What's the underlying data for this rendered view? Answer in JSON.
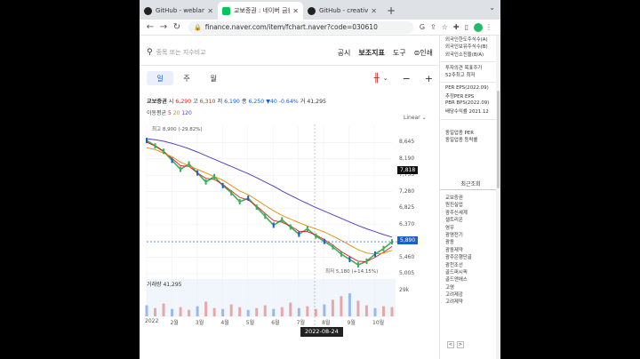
{
  "browser": {
    "tabs": [
      {
        "title": "GitHub - weblanks/Bl…",
        "favicon": "github-icon"
      },
      {
        "title": "교보증권 : 네이버 금융",
        "favicon": "naver-icon"
      },
      {
        "title": "GitHub - creativeduck…",
        "favicon": "github-icon"
      }
    ],
    "active_tab": 1,
    "new_tab": "+",
    "url": "finance.naver.com/item/fchart.naver?code=030610"
  },
  "search": {
    "placeholder": "종목 또는 지수비교",
    "menus": [
      "공시",
      "보조지표",
      "도구"
    ],
    "print": "인쇄"
  },
  "period": {
    "tabs": [
      "일",
      "주",
      "월"
    ],
    "active": 0
  },
  "price": {
    "name": "교보증권",
    "open_label": "시",
    "open": "6,290",
    "high_label": "고",
    "high": "6,310",
    "low_label": "저",
    "low": "6,190",
    "close_label": "종",
    "close": "6,250",
    "change": "▼40",
    "change_pct": "-0.64%",
    "volume_label": "거",
    "volume": "41,295"
  },
  "ma": {
    "label": "이동평균",
    "p5": "5",
    "p20": "20",
    "p120": "120"
  },
  "chart": {
    "scale": "Linear",
    "high_note": "최고 8,900 (-29.82%)",
    "low_note": "최저 5,180 (+14.15%)",
    "volume_label": "거래량 41,295",
    "volume_axis": "29k",
    "cursor_date": "2022-08-24",
    "current_price": "5,890",
    "cursor_price": "7,818",
    "colors": {
      "up": "#d22222",
      "down": "#1a5fd1",
      "ma5": "#d22222",
      "ma20": "#e28b00",
      "ma120": "#5b3fbf",
      "candle": "#3fae5a",
      "current": "#1a5fd1",
      "cursor": "#111111"
    }
  },
  "chart_data": {
    "type": "line",
    "title": "교보증권",
    "y_ticks": [
      "8,645",
      "8,190",
      "7,735",
      "7,280",
      "6,825",
      "6,370",
      "5,915",
      "5,460",
      "5,005"
    ],
    "ylim": [
      5005,
      8900
    ],
    "x_ticks": [
      "2022",
      "2월",
      "3월",
      "4월",
      "5월",
      "6월",
      "7월",
      "8월",
      "9월",
      "10월"
    ],
    "series": [
      {
        "name": "종가",
        "values": [
          8700,
          8550,
          8400,
          8150,
          7900,
          8050,
          7800,
          7550,
          7700,
          7450,
          7250,
          7000,
          7100,
          6850,
          6600,
          6350,
          6500,
          6300,
          6100,
          6250,
          6050,
          5900,
          5750,
          5550,
          5400,
          5250,
          5350,
          5550,
          5700,
          5890
        ]
      },
      {
        "name": "5",
        "values": [
          8650,
          8550,
          8400,
          8200,
          8000,
          7980,
          7800,
          7650,
          7620,
          7480,
          7300,
          7120,
          7050,
          6880,
          6680,
          6480,
          6430,
          6330,
          6180,
          6170,
          6080,
          5950,
          5800,
          5620,
          5480,
          5350,
          5340,
          5460,
          5600,
          5760
        ]
      },
      {
        "name": "20",
        "values": [
          8500,
          8450,
          8350,
          8250,
          8100,
          8000,
          7900,
          7800,
          7700,
          7600,
          7450,
          7300,
          7200,
          7050,
          6900,
          6750,
          6620,
          6520,
          6420,
          6330,
          6250,
          6160,
          6050,
          5930,
          5800,
          5670,
          5580,
          5550,
          5580,
          5650
        ]
      },
      {
        "name": "120",
        "values": [
          8750,
          8720,
          8680,
          8620,
          8550,
          8470,
          8380,
          8280,
          8180,
          8080,
          7980,
          7880,
          7780,
          7670,
          7550,
          7430,
          7300,
          7180,
          7060,
          6950,
          6840,
          6740,
          6640,
          6540,
          6440,
          6340,
          6250,
          6170,
          6090,
          6020
        ]
      }
    ],
    "volume": [
      12,
      9,
      14,
      8,
      10,
      7,
      11,
      16,
      9,
      8,
      13,
      10,
      7,
      9,
      12,
      8,
      10,
      15,
      9,
      11,
      8,
      13,
      18,
      22,
      25,
      17,
      12,
      9,
      11,
      10
    ],
    "volume_max": 29,
    "grid": true
  },
  "side": {
    "top_rows": [
      "외국인한도주식수(A)",
      "외국인보유주식수(B)",
      "외국인소진율(B/A)"
    ],
    "mid_rows": [
      "투자의견  목표주가",
      "52주최고  최저"
    ],
    "per_rows": [
      "PER  EPS(2022.09)",
      "추정PER  EPS",
      "PBR  BPS(2022.09)",
      "배당수익률  2021.12"
    ],
    "ind_rows": [
      "동일업종 PER",
      "동일업종 등락률"
    ],
    "recent_header": "최근조회",
    "recent_items": [
      "교보증권",
      "원진실업",
      "광주신세계",
      "셀트리온",
      "영우",
      "광명전기",
      "광동",
      "광동제약",
      "광주은행단골",
      "광천조선",
      "골드퍼시픽",
      "골드앤에스",
      "고영",
      "고려제강",
      "고려제약"
    ],
    "pager": [
      "<",
      ">"
    ]
  }
}
